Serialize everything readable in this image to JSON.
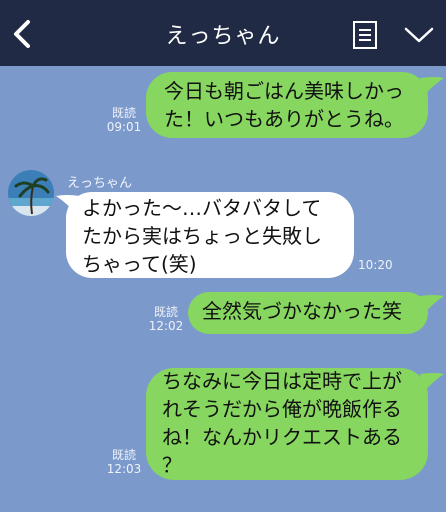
{
  "header": {
    "title": "えっちゃん",
    "back_icon": "chevron-left-icon",
    "menu_icon": "note-list-icon",
    "expand_icon": "chevron-down-icon"
  },
  "colors": {
    "header_bg": "#202a45",
    "chat_bg": "#7b9acb",
    "sent_bubble": "#86d65f",
    "received_bubble": "#ffffff"
  },
  "messages": [
    {
      "direction": "sent",
      "lines": [
        "今日も朝ごはん美味しかっ",
        "た！いつもありがとうね。"
      ],
      "read": "既読",
      "time": "09:01"
    },
    {
      "direction": "received",
      "sender": "えっちゃん",
      "lines": [
        "よかった〜…バタバタして",
        "たから実はちょっと失敗し",
        "ちゃって(笑)"
      ],
      "time": "10:20"
    },
    {
      "direction": "sent",
      "lines": [
        "全然気づかなかった笑"
      ],
      "read": "既読",
      "time": "12:02"
    },
    {
      "direction": "sent",
      "lines": [
        "ちなみに今日は定時で上が",
        "れそうだから俺が晩飯作る",
        "ね！なんかリクエストある",
        "？"
      ],
      "read": "既読",
      "time": "12:03"
    }
  ]
}
